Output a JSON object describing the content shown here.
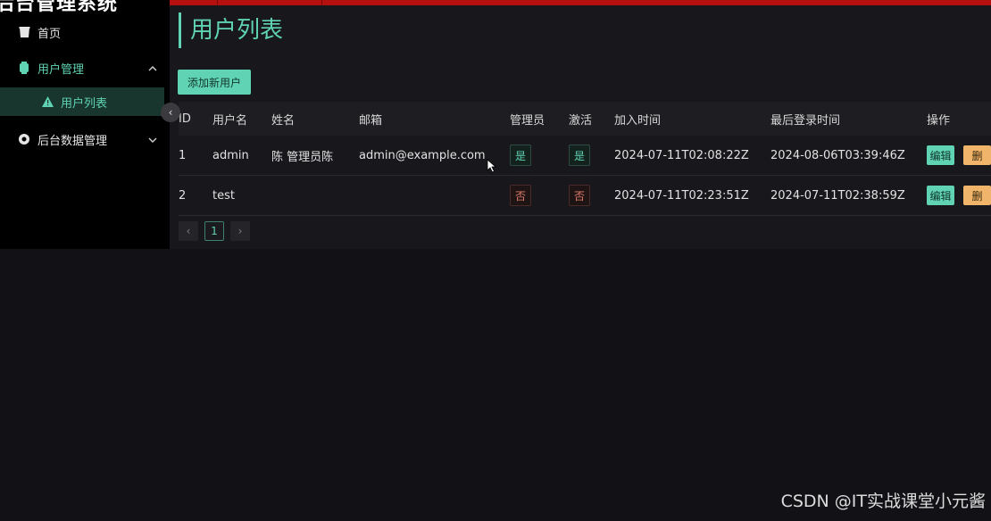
{
  "app": {
    "title": "后台管理系统"
  },
  "sidebar": {
    "items": [
      {
        "label": "首页",
        "icon": "home-icon"
      },
      {
        "label": "用户管理",
        "icon": "user-icon",
        "expanded": true
      },
      {
        "label": "用户列表",
        "icon": "warning-icon",
        "active": true
      },
      {
        "label": "后台数据管理",
        "icon": "data-icon",
        "expanded": false
      }
    ]
  },
  "page": {
    "title": "用户列表",
    "add_button": "添加新用户"
  },
  "table": {
    "headers": {
      "id": "ID",
      "username": "用户名",
      "name": "姓名",
      "email": "邮箱",
      "admin": "管理员",
      "active": "激活",
      "joined": "加入时间",
      "last_login": "最后登录时间",
      "ops": "操作"
    },
    "rows": [
      {
        "id": "1",
        "username": "admin",
        "name": "陈 管理员陈",
        "email": "admin@example.com",
        "admin": "是",
        "active": "是",
        "joined": "2024-07-11T02:08:22Z",
        "last_login": "2024-08-06T03:39:46Z",
        "edit": "编辑",
        "delete": "删"
      },
      {
        "id": "2",
        "username": "test",
        "name": "",
        "email": "",
        "admin": "否",
        "active": "否",
        "joined": "2024-07-11T02:23:51Z",
        "last_login": "2024-07-11T02:38:59Z",
        "edit": "编辑",
        "delete": "删"
      }
    ]
  },
  "pagination": {
    "prev": "‹",
    "current": "1",
    "next": "›"
  },
  "collapse": "‹",
  "watermark": "CSDN @IT实战课堂小元酱",
  "colors": {
    "accent": "#5fd3b3",
    "topbar": "#b3100f",
    "warning": "#f0b46a",
    "danger_text": "#e07b6b"
  }
}
